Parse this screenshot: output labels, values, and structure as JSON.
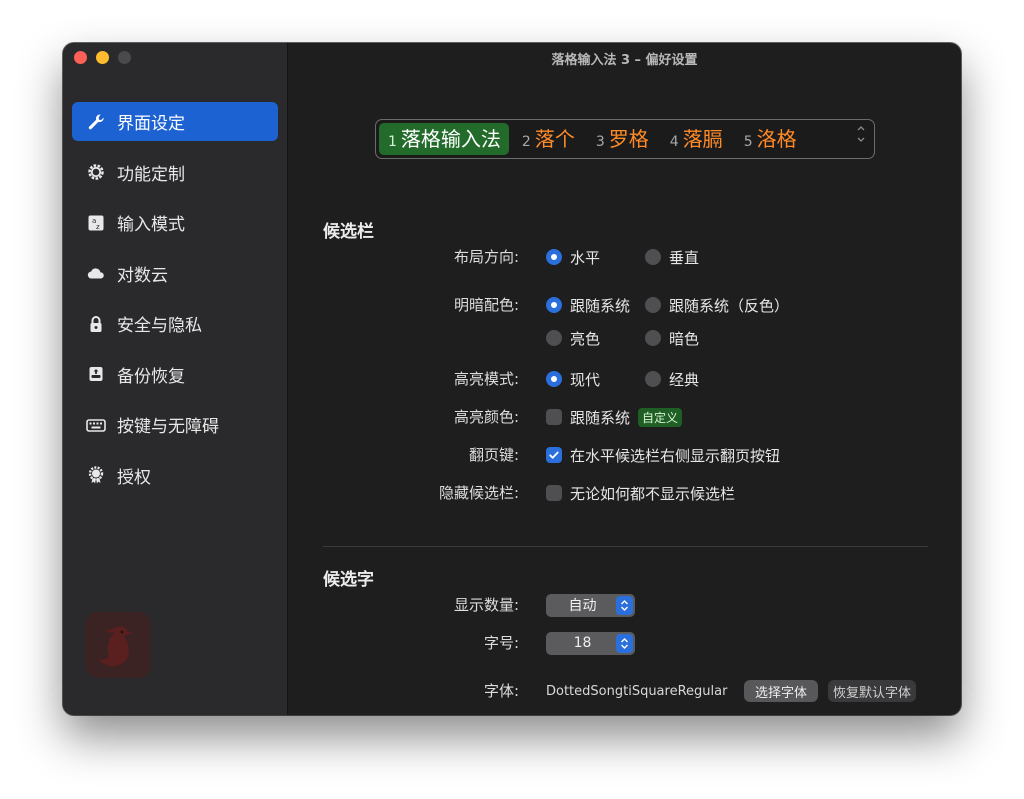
{
  "window": {
    "title": "落格输入法 3 – 偏好设置"
  },
  "sidebar": {
    "items": [
      {
        "label": "界面设定",
        "icon": "wrench-icon",
        "active": true
      },
      {
        "label": "功能定制",
        "icon": "gear-icon",
        "active": false
      },
      {
        "label": "输入模式",
        "icon": "input-mode-icon",
        "active": false
      },
      {
        "label": "对数云",
        "icon": "cloud-icon",
        "active": false
      },
      {
        "label": "安全与隐私",
        "icon": "lock-icon",
        "active": false
      },
      {
        "label": "备份恢复",
        "icon": "backup-icon",
        "active": false
      },
      {
        "label": "按键与无障碍",
        "icon": "keyboard-icon",
        "active": false
      },
      {
        "label": "授权",
        "icon": "seal-icon",
        "active": false
      }
    ],
    "app_icon": "goose-icon"
  },
  "preview": {
    "candidates": [
      {
        "num": "1",
        "text": "落格输入法",
        "selected": true
      },
      {
        "num": "2",
        "text": "落个",
        "selected": false
      },
      {
        "num": "3",
        "text": "罗格",
        "selected": false
      },
      {
        "num": "4",
        "text": "落膈",
        "selected": false
      },
      {
        "num": "5",
        "text": "洛格",
        "selected": false
      }
    ],
    "pager_icons": [
      "chevron-up-icon",
      "chevron-down-icon"
    ]
  },
  "candidate_bar": {
    "title": "候选栏",
    "layout": {
      "label": "布局方向:",
      "options": [
        "水平",
        "垂直"
      ],
      "selected": "水平"
    },
    "appearance": {
      "label": "明暗配色:",
      "options": [
        "跟随系统",
        "跟随系统（反色）",
        "亮色",
        "暗色"
      ],
      "selected": "跟随系统"
    },
    "highlight_mode": {
      "label": "高亮模式:",
      "options": [
        "现代",
        "经典"
      ],
      "selected": "现代"
    },
    "highlight_color": {
      "label": "高亮颜色:",
      "checkbox": "跟随系统",
      "checked": false,
      "badge": "自定义"
    },
    "page_keys": {
      "label": "翻页键:",
      "checkbox": "在水平候选栏右侧显示翻页按钮",
      "checked": true
    },
    "hide_bar": {
      "label": "隐藏候选栏:",
      "checkbox": "无论如何都不显示候选栏",
      "checked": false
    }
  },
  "candidate_text": {
    "title": "候选字",
    "count": {
      "label": "显示数量:",
      "value": "自动"
    },
    "font_size": {
      "label": "字号:",
      "value": "18"
    },
    "font": {
      "label": "字体:",
      "value": "DottedSongtiSquareRegular",
      "choose_button": "选择字体",
      "reset_button": "恢复默认字体"
    }
  },
  "colors": {
    "accent": "#1c62d3",
    "candidate_highlight": "#236b2b",
    "candidate_text": "#ff8a28",
    "window_bg": "#1e1e1f",
    "sidebar_bg": "#2a2a2d"
  }
}
